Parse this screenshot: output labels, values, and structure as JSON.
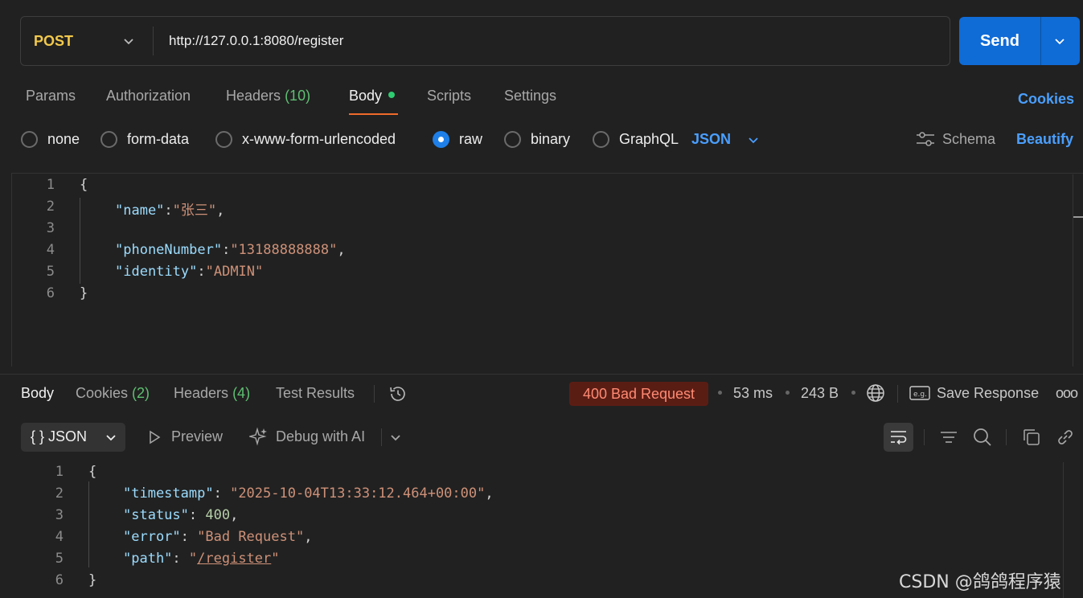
{
  "request": {
    "method": "POST",
    "url": "http://127.0.0.1:8080/register",
    "send_label": "Send",
    "tabs": [
      {
        "label": "Params"
      },
      {
        "label": "Authorization"
      },
      {
        "label": "Headers",
        "count": "(10)"
      },
      {
        "label": "Body",
        "active": true
      },
      {
        "label": "Scripts"
      },
      {
        "label": "Settings"
      }
    ],
    "cookies_label": "Cookies",
    "body_types": [
      "none",
      "form-data",
      "x-www-form-urlencoded",
      "raw",
      "binary",
      "GraphQL"
    ],
    "selected_body_type": "raw",
    "format": "JSON",
    "schema_label": "Schema",
    "beautify_label": "Beautify",
    "body_lines": [
      {
        "n": "1",
        "text": "{"
      },
      {
        "n": "2",
        "key": "\"name\"",
        "sep": ":",
        "value": "\"张三\"",
        "tail": ","
      },
      {
        "n": "3",
        "text": ""
      },
      {
        "n": "4",
        "key": "\"phoneNumber\"",
        "sep": ":",
        "value": "\"13188888888\"",
        "tail": ","
      },
      {
        "n": "5",
        "key": "\"identity\"",
        "sep": ":",
        "value": "\"ADMIN\"",
        "tail": ""
      },
      {
        "n": "6",
        "text": "}"
      }
    ]
  },
  "response": {
    "tabs": [
      {
        "label": "Body",
        "active": true
      },
      {
        "label": "Cookies",
        "count": "(2)"
      },
      {
        "label": "Headers",
        "count": "(4)"
      },
      {
        "label": "Test Results"
      }
    ],
    "status": "400 Bad Request",
    "time": "53 ms",
    "size": "243 B",
    "save_label": "Save Response",
    "more_label": "ooo",
    "format_label": "{ } JSON",
    "preview_label": "Preview",
    "debug_label": "Debug with AI",
    "body_lines": [
      {
        "n": "1",
        "text": "{"
      },
      {
        "n": "2",
        "key": "\"timestamp\"",
        "sep": ": ",
        "value": "\"2025-10-04T13:33:12.464+00:00\"",
        "tail": ","
      },
      {
        "n": "3",
        "key": "\"status\"",
        "sep": ": ",
        "value": "400",
        "tail": ","
      },
      {
        "n": "4",
        "key": "\"error\"",
        "sep": ": ",
        "value": "\"Bad Request\"",
        "tail": ","
      },
      {
        "n": "5",
        "key": "\"path\"",
        "sep": ": ",
        "value_pre": "\"",
        "value": "/register",
        "value_post": "\"",
        "tail": ""
      },
      {
        "n": "6",
        "text": "}"
      }
    ]
  },
  "watermark": "CSDN @鸽鸽程序猿",
  "colors": {
    "accent": "#0f6bd6",
    "method": "#f2c94c",
    "link": "#4a9fff",
    "error_badge": "#5a1d14",
    "error_text": "#ff8a73",
    "tab_underline": "#f06a2b"
  }
}
